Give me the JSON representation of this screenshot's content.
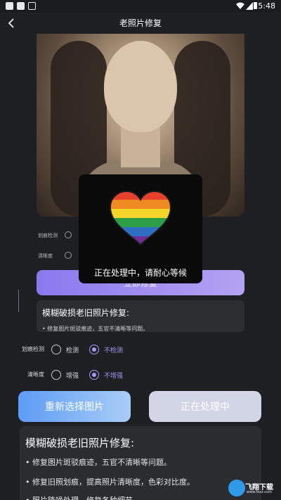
{
  "status_bar": {
    "time": "5:48"
  },
  "header": {
    "title": "老照片修复"
  },
  "background": {
    "option1_label": "划痕检测",
    "option2_label": "清晰度",
    "repair_button": "立即修复",
    "card_title": "模糊破损老旧照片修复:",
    "card_line": "• 修复图片斑驳痕迹，五官不清晰等问题。"
  },
  "dialog": {
    "text": "正在处理中，请耐心等候"
  },
  "options": {
    "scratch": {
      "label": "划痕检测",
      "choice_a": "检测",
      "choice_b": "不检测",
      "selected": "choice_b"
    },
    "clarity": {
      "label": "清晰度",
      "choice_a": "增强",
      "choice_b": "不增强",
      "selected": "choice_b"
    }
  },
  "buttons": {
    "reselect": "重新选择图片",
    "processing": "正在处理中"
  },
  "card": {
    "title": "模糊破损老旧照片修复:",
    "items": [
      "• 修复图片斑驳痕迹，五官不清晰等问题。",
      "• 修复旧照划痕，提高照片清晰度，色彩对比度。",
      "• 照片降噪处理，修复各种细节。"
    ]
  },
  "watermark": {
    "text": "飞翔下载",
    "sub": "www.fxxz.com"
  },
  "colors": {
    "accent": "#a796f4",
    "background": "#1e1f23",
    "card": "#2b2c30"
  }
}
